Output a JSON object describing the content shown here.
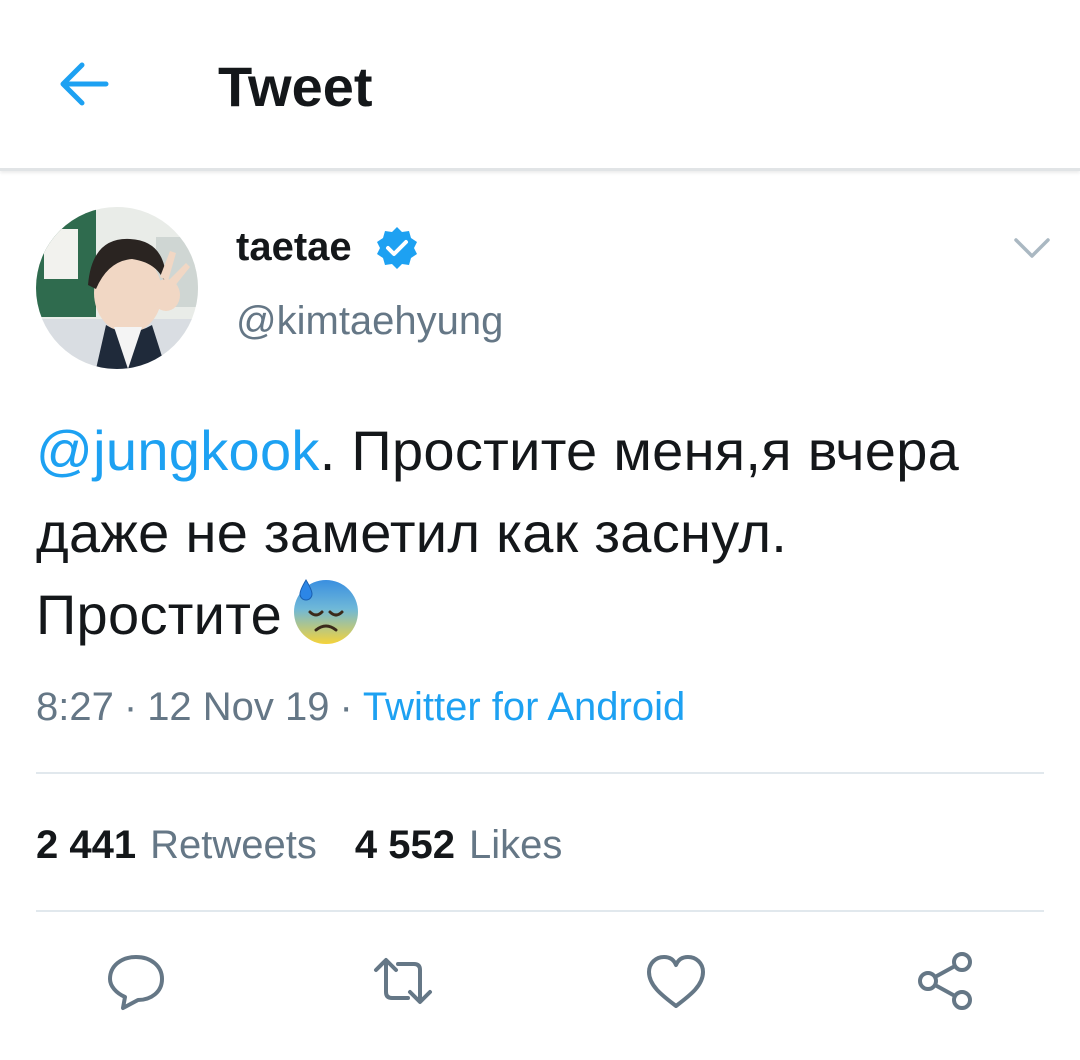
{
  "header": {
    "back_icon": "arrow-left-icon",
    "title": "Tweet",
    "accent_color": "#1da1f2"
  },
  "tweet": {
    "author": {
      "display_name": "taetae",
      "handle": "@kimtaehyung",
      "verified": true,
      "verified_icon": "verified-badge-icon"
    },
    "more_icon": "chevron-down-icon",
    "mention": "@jungkook",
    "text": ". Простите меня,я вчера даже не заметил как заснул. Простите",
    "emoji": "anxious-face-with-sweat-emoji",
    "time": "8:27",
    "date": "12 Nov 19",
    "separator": "·",
    "source": "Twitter for Android"
  },
  "stats": {
    "retweets_count": "2 441",
    "retweets_label": "Retweets",
    "likes_count": "4 552",
    "likes_label": "Likes"
  },
  "actions": [
    {
      "name": "reply",
      "icon": "comment-icon"
    },
    {
      "name": "retweet",
      "icon": "retweet-icon"
    },
    {
      "name": "like",
      "icon": "heart-icon"
    },
    {
      "name": "share",
      "icon": "share-icon"
    }
  ],
  "colors": {
    "text_primary": "#14171a",
    "text_secondary": "#657786",
    "link": "#1da1f2",
    "divider": "#e1e8ed"
  }
}
